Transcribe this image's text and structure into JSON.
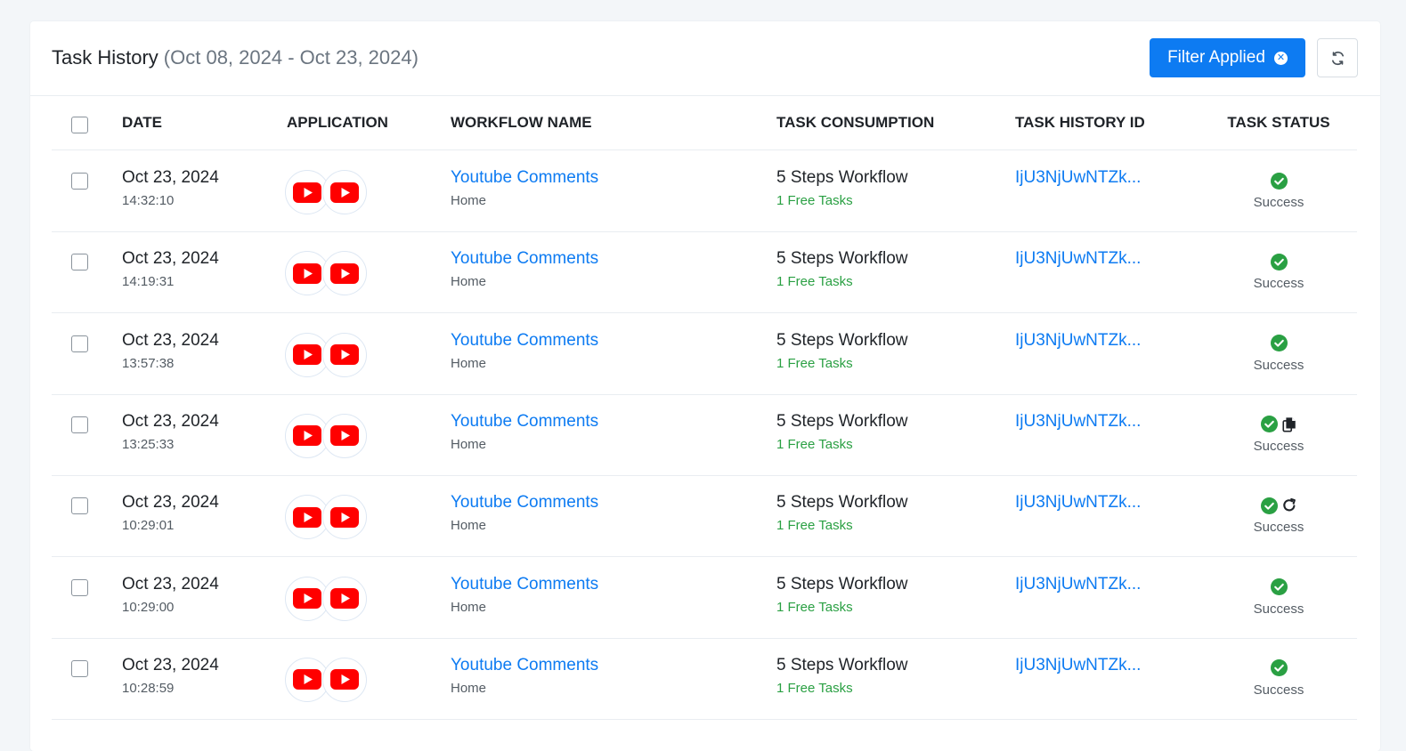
{
  "header": {
    "title": "Task History",
    "date_range": "(Oct 08, 2024 - Oct 23, 2024)",
    "filter_button": "Filter Applied",
    "filter_clear_icon": "close-circle-icon",
    "refresh_icon": "refresh-icon"
  },
  "columns": {
    "date": "DATE",
    "application": "APPLICATION",
    "workflow": "WORKFLOW NAME",
    "consumption": "TASK CONSUMPTION",
    "history_id": "TASK HISTORY ID",
    "status": "TASK STATUS"
  },
  "colors": {
    "accent": "#0d7bf2",
    "success": "#2aa043",
    "youtube": "#ff0000"
  },
  "rows": [
    {
      "date": "Oct 23, 2024",
      "time": "14:32:10",
      "apps": [
        "youtube-icon",
        "youtube-icon"
      ],
      "workflow": "Youtube Comments",
      "folder": "Home",
      "consumption": "5 Steps Workflow",
      "free": "1 Free Tasks",
      "history_id": "IjU3NjUwNTZk...",
      "status": "Success",
      "extra_icon": ""
    },
    {
      "date": "Oct 23, 2024",
      "time": "14:19:31",
      "apps": [
        "youtube-icon",
        "youtube-icon"
      ],
      "workflow": "Youtube Comments",
      "folder": "Home",
      "consumption": "5 Steps Workflow",
      "free": "1 Free Tasks",
      "history_id": "IjU3NjUwNTZk...",
      "status": "Success",
      "extra_icon": ""
    },
    {
      "date": "Oct 23, 2024",
      "time": "13:57:38",
      "apps": [
        "youtube-icon",
        "youtube-icon"
      ],
      "workflow": "Youtube Comments",
      "folder": "Home",
      "consumption": "5 Steps Workflow",
      "free": "1 Free Tasks",
      "history_id": "IjU3NjUwNTZk...",
      "status": "Success",
      "extra_icon": ""
    },
    {
      "date": "Oct 23, 2024",
      "time": "13:25:33",
      "apps": [
        "youtube-icon",
        "youtube-icon"
      ],
      "workflow": "Youtube Comments",
      "folder": "Home",
      "consumption": "5 Steps Workflow",
      "free": "1 Free Tasks",
      "history_id": "IjU3NjUwNTZk...",
      "status": "Success",
      "extra_icon": "copy-icon"
    },
    {
      "date": "Oct 23, 2024",
      "time": "10:29:01",
      "apps": [
        "youtube-icon",
        "youtube-icon"
      ],
      "workflow": "Youtube Comments",
      "folder": "Home",
      "consumption": "5 Steps Workflow",
      "free": "1 Free Tasks",
      "history_id": "IjU3NjUwNTZk...",
      "status": "Success",
      "extra_icon": "rerun-icon"
    },
    {
      "date": "Oct 23, 2024",
      "time": "10:29:00",
      "apps": [
        "youtube-icon",
        "youtube-icon"
      ],
      "workflow": "Youtube Comments",
      "folder": "Home",
      "consumption": "5 Steps Workflow",
      "free": "1 Free Tasks",
      "history_id": "IjU3NjUwNTZk...",
      "status": "Success",
      "extra_icon": ""
    },
    {
      "date": "Oct 23, 2024",
      "time": "10:28:59",
      "apps": [
        "youtube-icon",
        "youtube-icon"
      ],
      "workflow": "Youtube Comments",
      "folder": "Home",
      "consumption": "5 Steps Workflow",
      "free": "1 Free Tasks",
      "history_id": "IjU3NjUwNTZk...",
      "status": "Success",
      "extra_icon": ""
    }
  ]
}
